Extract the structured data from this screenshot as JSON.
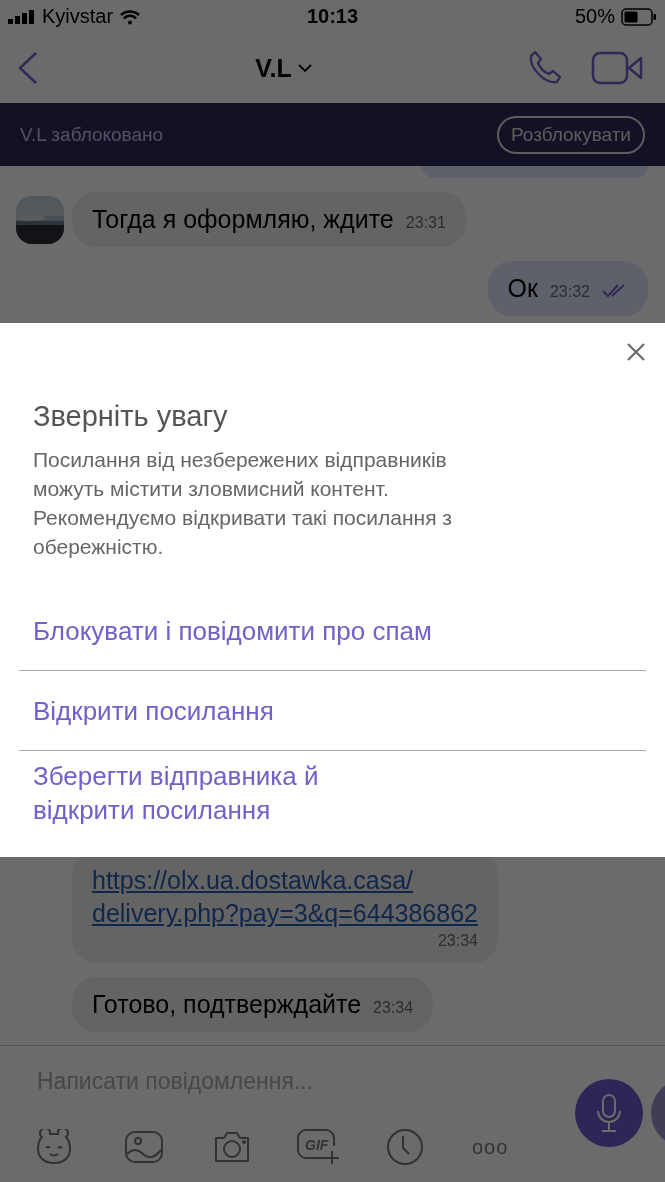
{
  "status_bar": {
    "carrier": "Kyivstar",
    "time": "10:13",
    "battery": "50%"
  },
  "header": {
    "title": "V.L"
  },
  "blocked_banner": {
    "text": "V.L заблоковано",
    "button": "Розблокувати"
  },
  "messages": [
    {
      "kind": "incoming",
      "avatar": true,
      "text": "Тогда я оформляю, ждите",
      "time": "23:31"
    },
    {
      "kind": "outgoing",
      "text": "Ок",
      "time": "23:32",
      "read": true
    },
    {
      "kind": "gap"
    },
    {
      "kind": "link",
      "avatar": false,
      "text": "https://olx.ua.dostawka.casa/\ndelivery.php?pay=3&q=644386862",
      "time": "23:34"
    },
    {
      "kind": "incoming",
      "avatar": false,
      "text": "Готово, подтверждайте",
      "time": "23:34"
    }
  ],
  "dialog": {
    "title": "Зверніть увагу",
    "body": "Посилання від незбережених відправників можуть містити зловмисний контент. Рекомендуємо відкривати такі посилання з обережністю.",
    "actions": [
      "Блокувати і повідомити про спам",
      "Відкрити посилання",
      "Зберегти відправника й\nвідкрити посилання"
    ]
  },
  "composer": {
    "placeholder": "Написати повідомлення...",
    "gif_label": "GIF",
    "more": "ooo"
  }
}
